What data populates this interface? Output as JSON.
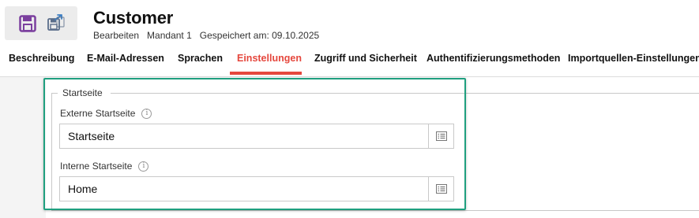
{
  "header": {
    "title": "Customer",
    "meta": [
      "Bearbeiten",
      "Mandant 1",
      "Gespeichert am: 09.10.2025"
    ]
  },
  "toolbar": {
    "save_icon": "save-icon",
    "save_as_icon": "save-as-icon"
  },
  "tabs": [
    {
      "label": "Beschreibung"
    },
    {
      "label": "E-Mail-Adressen"
    },
    {
      "label": "Sprachen"
    },
    {
      "label": "Einstellungen",
      "active": true
    },
    {
      "label": "Zugriff und Sicherheit"
    },
    {
      "label": "Authentifizierungsmethoden"
    },
    {
      "label": "Importquellen-Einstellungen"
    }
  ],
  "section": {
    "legend": "Startseite",
    "fields": [
      {
        "label": "Externe Startseite",
        "value": "Startseite"
      },
      {
        "label": "Interne Startseite",
        "value": "Home"
      }
    ]
  },
  "colors": {
    "accent": "#e5473d",
    "highlight": "#1f9f7f",
    "icon_purple": "#7b3f9e"
  }
}
